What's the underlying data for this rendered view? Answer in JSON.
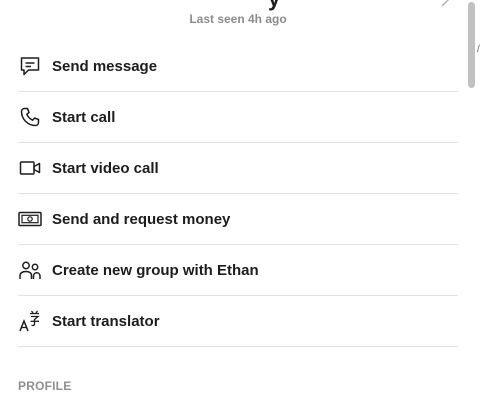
{
  "header": {
    "contact_name_fragment": "y",
    "last_seen": "Last seen 4h ago"
  },
  "actions": [
    {
      "label": "Send message",
      "icon": "message-icon"
    },
    {
      "label": "Start call",
      "icon": "phone-icon"
    },
    {
      "label": "Start video call",
      "icon": "video-camera-icon"
    },
    {
      "label": "Send and request money",
      "icon": "money-icon"
    },
    {
      "label": "Create new group with Ethan",
      "icon": "people-icon"
    },
    {
      "label": "Start translator",
      "icon": "translate-icon"
    }
  ],
  "profile": {
    "section_title": "PROFILE"
  },
  "edge_glyph": "/"
}
